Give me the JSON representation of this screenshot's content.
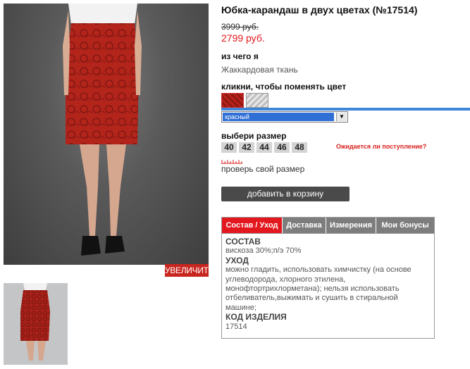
{
  "product": {
    "title": "Юбка-карандаш в двух цветах (№17514)",
    "old_price": "3999 руб.",
    "new_price": "2799 руб.",
    "material_label": "из чего я",
    "material_value": "Жаккардовая ткань",
    "color_label": "кликни, чтобы поменять цвет",
    "color_selected": "красный",
    "size_label": "выбери размер",
    "sizes": [
      "40",
      "42",
      "44",
      "46",
      "48"
    ],
    "notify_link": "Ожидается ли поступление?",
    "check_size_link": "проверь свой размер",
    "add_to_cart": "добавить в корзину",
    "zoom_label": "УВЕЛИЧИТЬ"
  },
  "swatches": [
    {
      "icon": "red-jacquard-swatch",
      "color": "#b8221a"
    },
    {
      "icon": "grey-jacquard-swatch",
      "color": "#c8c8c8"
    }
  ],
  "tabs": {
    "items": [
      "Состав / Уход",
      "Доставка",
      "Измерения",
      "Мои бонусы"
    ],
    "active": 0,
    "active_color": "#e2181e"
  },
  "composition": {
    "heading": "СОСТАВ",
    "value": "вискоза 30%;п/э 70%",
    "care_heading": "УХОД",
    "care_text": "можно гладить, использовать химчистку (на основе углеводорода, хлорного этилена, монофтортрихлорметана); нельзя использовать отбеливатель,выжимать и сушить в стиральной машине;",
    "code_heading": "КОД ИЗДЕЛИЯ",
    "code_value": "17514"
  },
  "colors": {
    "accent_red": "#e0161a",
    "select_blue": "#2f6fd6",
    "button_dark": "#4a4a4a"
  }
}
